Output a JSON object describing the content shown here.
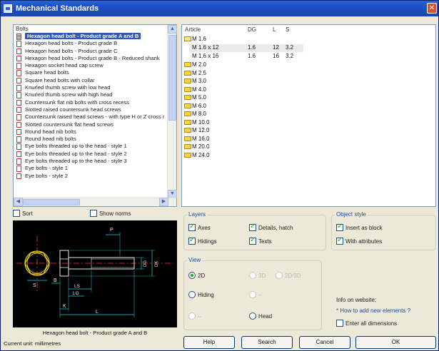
{
  "window": {
    "title": "Mechanical Standards"
  },
  "bolts": {
    "header": "Bolts",
    "items": [
      "Hexagon head bolt - Product grade A and B",
      "Hexagon head bolts - Product grade B",
      "Hexagon head bolts - Product grade C",
      "Hexagon head bolts - Product grade B - Reduced shank",
      "Hexagon socket head cap screw",
      "Square head bolts",
      "Square head bolts with collar",
      "Knurled thumb screw with low head",
      "Knurled thumb screw with high head",
      "Countersunk flat nib bolts with cross recess",
      "Slotted raised countersunk head screws",
      "Countersunk raised head screws - with type H or Z cross r",
      "Slotted countersunk flat head screws",
      "Round head nib bolts",
      "Round head nib bolts",
      "Eye bolts threaded up to the head - style 1",
      "Eye bolts threaded up to the head - style 2",
      "Eye bolts threaded up to the head - style 3",
      "Eye bolts - style 1",
      "Eye bolts - style 2"
    ],
    "selected_index": 0
  },
  "articles": {
    "headers": {
      "article": "Article",
      "dg": "DG",
      "l": "L",
      "s": "S"
    },
    "open_folder": "M 1.6",
    "rows": [
      {
        "article": "M 1.6 x 12",
        "dg": "1.6",
        "l": "12",
        "s": "3.2"
      },
      {
        "article": "M 1.6 x 16",
        "dg": "1.6",
        "l": "16",
        "s": "3.2"
      }
    ],
    "folders": [
      "M 2.0",
      "M 2.5",
      "M 3.0",
      "M 4.0",
      "M 5.0",
      "M 6.0",
      "M 8.0",
      "M 10.0",
      "M 12.0",
      "M 16.0",
      "M 20.0",
      "M 24.0"
    ]
  },
  "options": {
    "sort": "Sort",
    "show_norms": "Show norms"
  },
  "preview": {
    "caption": "Hexagon head bolt - Product grade A and B",
    "units": "Current unit: millimetres",
    "labels": {
      "p": "P",
      "s": "S",
      "b": "B",
      "ls": "LS",
      "lg": "LG",
      "k": "K",
      "l": "L",
      "dg": "DG",
      "dk": "DK"
    }
  },
  "layers": {
    "title": "Layers",
    "axes": "Axes",
    "hidings": "Hidings",
    "details": "Details, hatch",
    "texts": "Texts"
  },
  "object_style": {
    "title": "Object style",
    "insert_block": "Insert as block",
    "with_attributes": "With attributes"
  },
  "view": {
    "title": "View",
    "opt_2d": "2D",
    "opt_3d": "3D",
    "opt_2d3d": "2D/3D",
    "hiding": "Hiding",
    "dash1": "--",
    "dash2": "--",
    "head": "Head"
  },
  "info": {
    "title": "Info on website:",
    "link": "* How to add new elements ?",
    "enter_all": "Enter all dimensions"
  },
  "buttons": {
    "help": "Help",
    "search": "Search",
    "cancel": "Cancel",
    "ok": "OK"
  },
  "colors": {
    "title_bar": "#1b4fc4",
    "selection": "#2f57b5",
    "group_label": "#1c4ea5",
    "check": "#21a121"
  }
}
